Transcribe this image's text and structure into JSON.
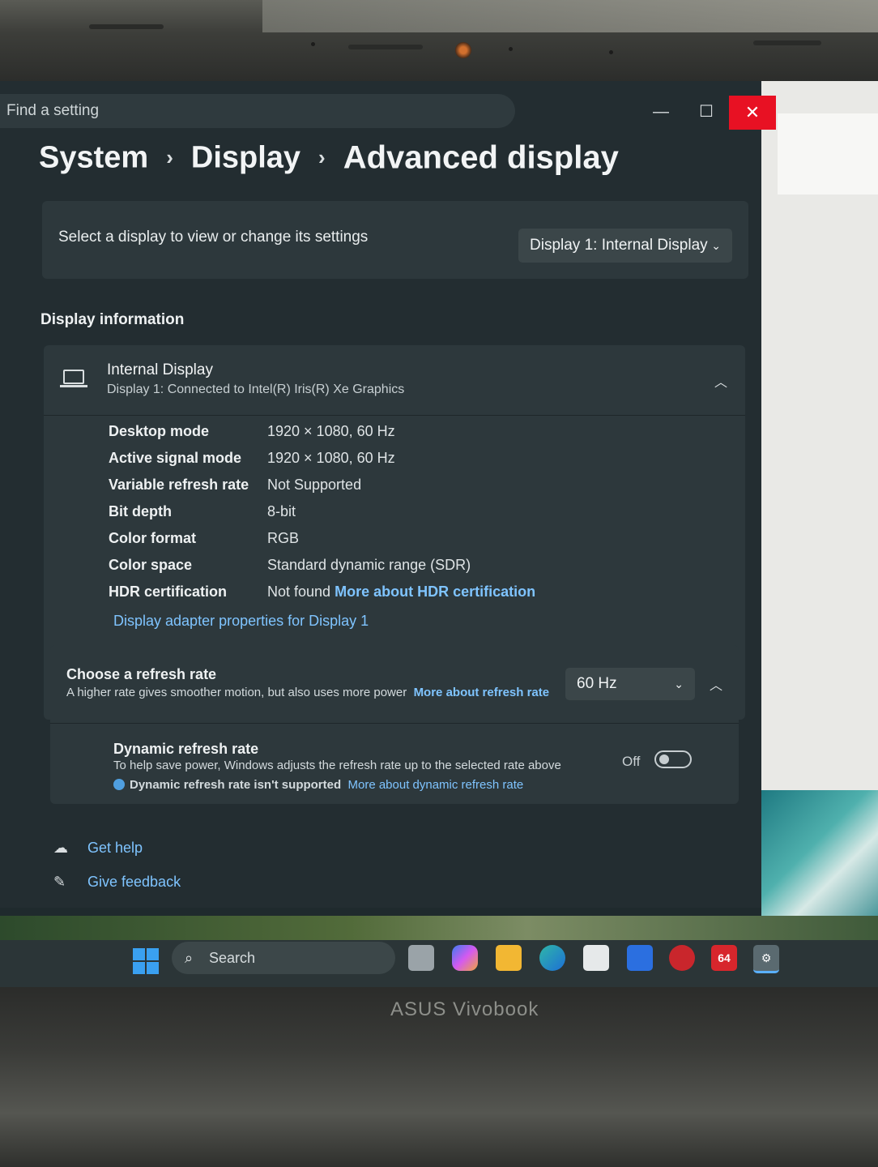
{
  "window": {
    "search_placeholder": "Find a setting",
    "minimize_icon": "—",
    "maximize_icon": "☐",
    "close_icon": "✕"
  },
  "breadcrumb": {
    "items": [
      "System",
      "Display",
      "Advanced display"
    ],
    "separator": "›"
  },
  "select_display": {
    "label": "Select a display to view or change its settings",
    "value": "Display 1: Internal Display"
  },
  "display_information": {
    "section_title": "Display information",
    "title": "Internal Display",
    "subtitle": "Display 1: Connected to Intel(R) Iris(R) Xe Graphics",
    "rows": [
      {
        "key": "Desktop mode",
        "value": "1920 × 1080, 60 Hz"
      },
      {
        "key": "Active signal mode",
        "value": "1920 × 1080, 60 Hz"
      },
      {
        "key": "Variable refresh rate",
        "value": "Not Supported"
      },
      {
        "key": "Bit depth",
        "value": "8-bit"
      },
      {
        "key": "Color format",
        "value": "RGB"
      },
      {
        "key": "Color space",
        "value": "Standard dynamic range (SDR)"
      },
      {
        "key": "HDR certification",
        "value": "Not found"
      }
    ],
    "hdr_link": "More about HDR certification",
    "adapter_link": "Display adapter properties for Display 1"
  },
  "refresh_rate": {
    "title": "Choose a refresh rate",
    "description": "A higher rate gives smoother motion, but also uses more power",
    "link": "More about refresh rate",
    "value": "60 Hz",
    "dynamic": {
      "title": "Dynamic refresh rate",
      "description": "To help save power, Windows adjusts the refresh rate up to the selected rate above",
      "note": "Dynamic refresh rate isn't supported",
      "link": "More about dynamic refresh rate",
      "toggle_label": "Off"
    }
  },
  "help": {
    "get_help": "Get help",
    "give_feedback": "Give feedback"
  },
  "taskbar": {
    "search_label": "Search",
    "badge_64": "64"
  },
  "brand": "ASUS Vivobook",
  "colors": {
    "accent_link": "#7fc4ff",
    "close_red": "#e81123",
    "window_bg": "#232d31",
    "card_bg": "#2d383c"
  }
}
